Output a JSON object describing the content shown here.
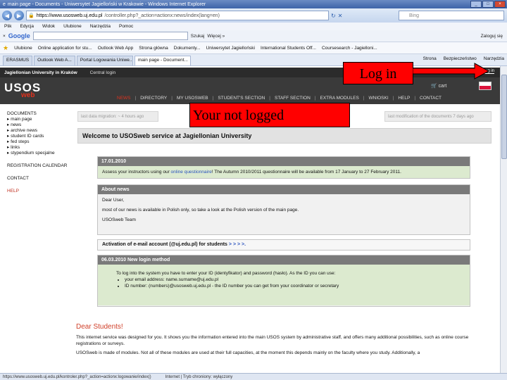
{
  "window": {
    "title": "main page - Documents - Uniwersytet Jagielloński w Krakowie - Windows Internet Explorer"
  },
  "address_bar": {
    "url_domain": "https://www.usosweb.uj.edu.pl",
    "url_rest": "/controller.php?_action=actionx:news/index(lang=en)",
    "search_placeholder": "Bing"
  },
  "menu": [
    "Plik",
    "Edycja",
    "Widok",
    "Ulubione",
    "Narzędzia",
    "Pomoc"
  ],
  "google_bar": {
    "logo": "Google",
    "items": [
      "Szukaj",
      "Więcej »",
      "Zaloguj się"
    ]
  },
  "favorites": [
    "Ulubione",
    "Online application for stu...",
    "Outlook Web App",
    "Strona główna",
    "Dokumenty...",
    "Uniwersytet Jagielloński",
    "International Students Off...",
    "Coursesearch - Jagielloni..."
  ],
  "tabs": [
    {
      "label": "ERASMUS",
      "active": false
    },
    {
      "label": "Outlook Web A...",
      "active": false
    },
    {
      "label": "Portal Logowania Uniwe...",
      "active": false
    },
    {
      "label": "main page - Document...",
      "active": true
    }
  ],
  "tab_tools": [
    "Strona",
    "Bezpieczeństwo",
    "Narzędzia"
  ],
  "site_header": {
    "university": "Jagiellonian University in Kraków",
    "central_login": "Central login",
    "login_link": "log in"
  },
  "brand": {
    "logo": "USOS",
    "sub": "web",
    "cart": "cart"
  },
  "nav_links": [
    "NEWS",
    "DIRECTORY",
    "MY USOSWEB",
    "STUDENT'S SECTION",
    "STAFF SECTION",
    "EXTRA MODULES",
    "WNIOSKI",
    "HELP",
    "CONTACT"
  ],
  "sidebar": {
    "documents_head": "DOCUMENTS",
    "documents_items": [
      "main page",
      "news",
      "archive news",
      "student ID cards",
      "fed steps",
      "links",
      "stypendium specjalne"
    ],
    "registration": "REGISTRATION CALENDAR",
    "contact": "CONTACT",
    "help": "HELP"
  },
  "notices": {
    "left": "last data migration: ~ 4 hours ago",
    "right": "last modification of the documents 7 days ago"
  },
  "welcome": {
    "text": "Welcome to USOSweb service at",
    "university": "Jagiellonian University"
  },
  "boxes": {
    "date_head": "17.01.2010",
    "date_body_pre": "Assess your instructors using our",
    "date_body_link": "online questionnaire",
    "date_body_post": "! The Autumn 2010/2011 questionnaire will be available from 17 January to 27 February 2011.",
    "news_head": "About news",
    "news_greet": "Dear User,",
    "news_body": "most of our news is available in Polish only, so take a look at the Polish version of the main page.",
    "news_sign": "USOSweb Team",
    "activation": "Activation of e-mail account (@uj.edu.pl) for students",
    "activation_arrows": "> > > >.",
    "login_head": "06.03.2010 New login method",
    "login_intro": "To log into the system you have to enter your ID (identyfikator) and password (hasło). As the ID you can use:",
    "login_bullet1": "your email address: name.surname@uj.edu.pl",
    "login_bullet2": "ID number: (numbers)@usosweb.uj.edu.pl - the ID number you can get from your coordinator or secretary"
  },
  "students": {
    "heading": "Dear Students!",
    "p1": "This internet service was designed for you. It shows you the information entered into the main USOS system by administrative staff, and offers many additional possibilities, such as online course registrations or surveys.",
    "p2": "USOSweb is made of modules. Not all of these modules are used at their full capacities, at the moment this depends mainly on the faculty where you study. Additionally, a"
  },
  "status_bar": {
    "url": "https://www.usosweb.uj.edu.pl/kontroler.php?_action=actionx:logowanie/index()",
    "zone": "Internet | Tryb chroniony: wyłączony"
  },
  "annotations": {
    "login": "Log in",
    "not_logged": "Your not logged"
  },
  "colors": {
    "annotation_red": "#ff0000",
    "usos_red": "#e0321e",
    "box_header": "#7a7a7a",
    "box_green": "#dceacf"
  }
}
